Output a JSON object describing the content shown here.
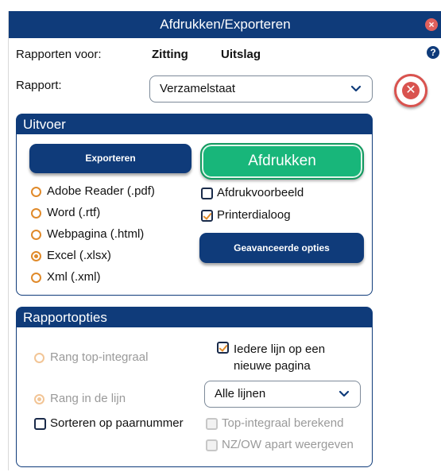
{
  "window": {
    "title": "Afdrukken/Exporteren",
    "close_icon": "close-icon"
  },
  "header": {
    "reports_for_label": "Rapporten voor:",
    "session_label": "Zitting",
    "result_label": "Uitslag",
    "help_glyph": "?"
  },
  "report": {
    "label": "Rapport:",
    "selected": "Verzamelstaat"
  },
  "output": {
    "title": "Uitvoer",
    "export_button": "Exporteren",
    "print_button": "Afdrukken",
    "formats": [
      {
        "label": "Adobe Reader (.pdf)",
        "checked": false
      },
      {
        "label": "Word (.rtf)",
        "checked": false
      },
      {
        "label": "Webpagina (.html)",
        "checked": false
      },
      {
        "label": "Excel (.xlsx)",
        "checked": true
      },
      {
        "label": "Xml (.xml)",
        "checked": false
      }
    ],
    "print_preview_label": "Afdrukvoorbeeld",
    "print_preview_checked": false,
    "printer_dialog_label": "Printerdialoog",
    "printer_dialog_checked": true,
    "advanced_button": "Geavanceerde opties"
  },
  "report_options": {
    "title": "Rapportopties",
    "rank_top_integral": "Rang top-integraal",
    "rank_in_line": "Rang in de lijn",
    "each_line_new_page": "Iedere lijn op een nieuwe pagina",
    "each_line_new_page_checked": true,
    "lines_select": "Alle lijnen",
    "sort_pair_number": "Sorteren op paarnummer",
    "sort_pair_number_checked": false,
    "top_integral_calculated": "Top-integraal berekend",
    "nz_ow_separate": "NZ/OW apart weergeven"
  },
  "colors": {
    "brand": "#0f3b7a",
    "accent": "#e08a2a",
    "print": "#18b67a",
    "danger": "#d9534f"
  }
}
